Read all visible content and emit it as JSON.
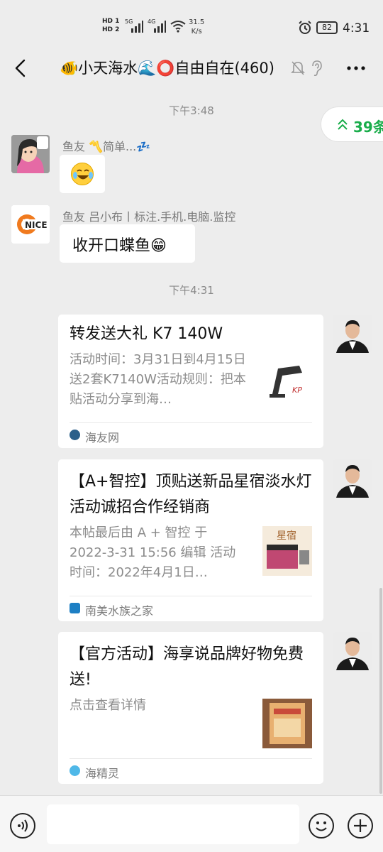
{
  "status_bar": {
    "hd1": "HD 1",
    "hd2": "HD 2",
    "net1": "5G",
    "net2": "4G",
    "speed_value": "31.5",
    "speed_unit": "K/s",
    "battery": "82",
    "time": "4:31"
  },
  "header": {
    "title": "🐠小天海水🌊⭕自由自在(460)",
    "more_label": "⋯"
  },
  "unread": {
    "count_label": "39条"
  },
  "messages": [
    {
      "timestamp": "下午3:48",
      "sender": "鱼友 〽️简单...💤",
      "content": ""
    },
    {
      "sender": "鱼友 吕小布丨标注.手机.电脑.监控",
      "content": "收开口蝶鱼😁",
      "avatar_label": "NICE"
    }
  ],
  "timestamp2": "下午4:31",
  "cards": [
    {
      "title": "转发送大礼 K7 140W",
      "desc": "活动时间：3月31日到4月15日送2套K7140W活动规则：把本贴活动分享到海…",
      "source": "海友网",
      "thumb_label": "KP"
    },
    {
      "title": "【A+智控】顶贴送新品星宿淡水灯活动诚招合作经销商",
      "desc": " 本帖最后由 A + 智控 于 2022-3-31 15:56 编辑 活动时间：2022年4月1日…",
      "source": "南美水族之家",
      "thumb_label": "星宿"
    },
    {
      "title": "【官方活动】海享说品牌好物免费送!",
      "desc": "点击查看详情",
      "source": "海精灵",
      "thumb_label": ""
    }
  ],
  "input": {
    "placeholder": ""
  },
  "colors": {
    "background": "#ededed",
    "accent_green": "#1aad4b",
    "bubble": "#ffffff",
    "meta_gray": "#8a8a8a"
  },
  "icons": [
    "back-icon",
    "mute-icon",
    "earpiece-icon",
    "more-icon",
    "voice-icon",
    "emoji-icon",
    "plus-icon",
    "double-chevron-up-icon"
  ]
}
